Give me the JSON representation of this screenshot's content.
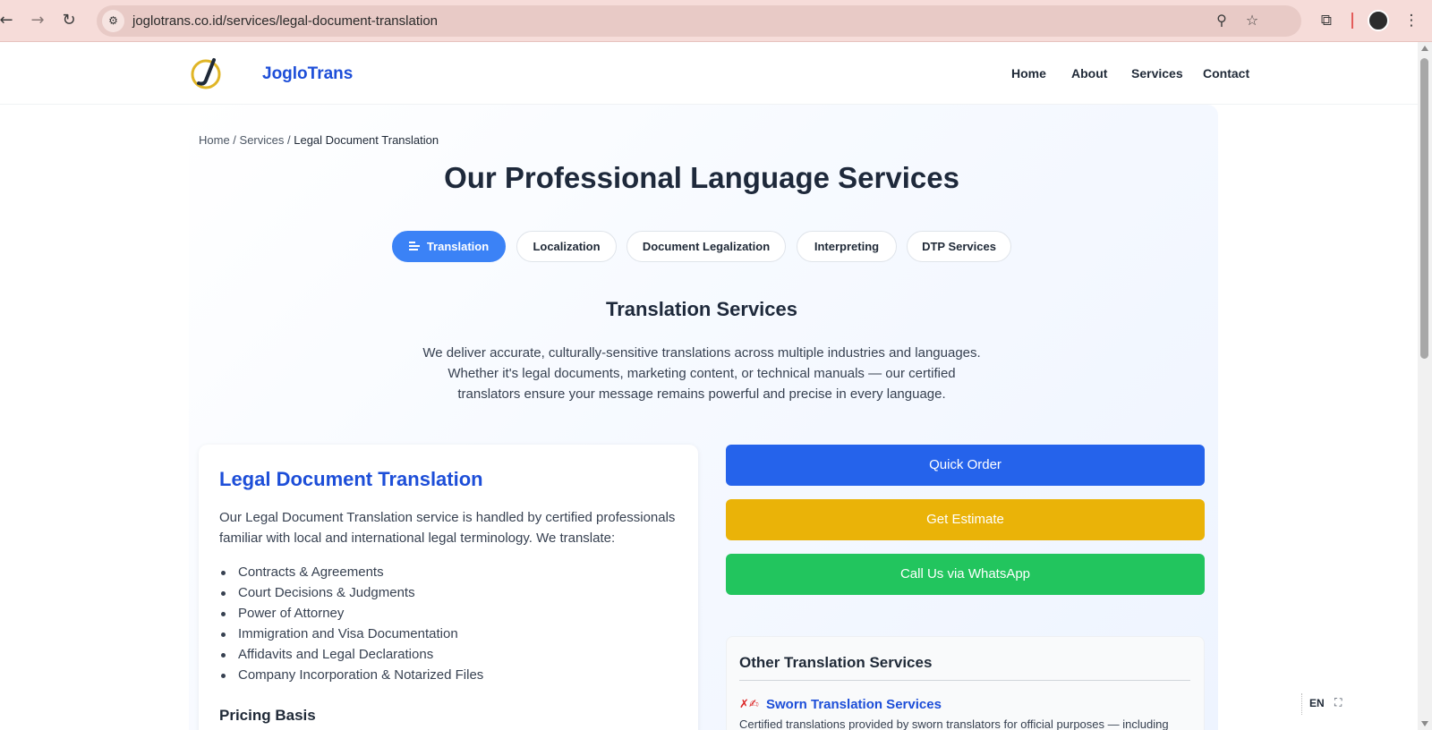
{
  "browser": {
    "url": "joglotrans.co.id/services/legal-document-translation",
    "icons": {
      "back": "arrow-left-icon",
      "forward": "arrow-right-icon",
      "reload": "reload-icon",
      "site_info": "tune-icon",
      "zoom": "zoom-icon",
      "bookmark": "star-icon",
      "extensions": "puzzle-icon",
      "menu": "kebab-menu-icon"
    }
  },
  "header": {
    "brand": "JogloTrans",
    "nav": [
      "Home",
      "About",
      "Services",
      "Contact"
    ]
  },
  "breadcrumb": {
    "home": "Home",
    "sep1": " / ",
    "services": "Services",
    "sep2": " / ",
    "current": "Legal Document Translation"
  },
  "page_title": "Our Professional Language Services",
  "tabs": [
    {
      "label": "Translation",
      "active": true
    },
    {
      "label": "Localization",
      "active": false
    },
    {
      "label": "Document Legalization",
      "active": false
    },
    {
      "label": "Interpreting",
      "active": false
    },
    {
      "label": "DTP Services",
      "active": false
    }
  ],
  "section": {
    "title": "Translation Services",
    "desc_line1": "We deliver accurate, culturally-sensitive translations across multiple industries and languages.",
    "desc_line2": "Whether it's legal documents, marketing content, or technical manuals — our certified",
    "desc_line3": "translators ensure your message remains powerful and precise in every language."
  },
  "card": {
    "title": "Legal Document Translation",
    "intro": "Our Legal Document Translation service is handled by certified professionals familiar with local and international legal terminology. We translate:",
    "items": [
      "Contracts & Agreements",
      "Court Decisions & Judgments",
      "Power of Attorney",
      "Immigration and Visa Documentation",
      "Affidavits and Legal Declarations",
      "Company Incorporation & Notarized Files"
    ],
    "pricing_title": "Pricing Basis"
  },
  "actions": {
    "quick_order": "Quick Order",
    "estimate": "Get Estimate",
    "whatsapp": "Call Us via WhatsApp"
  },
  "other_services": {
    "title": "Other Translation Services",
    "item_title": "Sworn Translation Services",
    "item_desc": "Certified translations provided by sworn translators for official purposes — including"
  },
  "language_widget": {
    "label": "EN"
  },
  "colors": {
    "primary": "#2563eb",
    "estimate": "#eab308",
    "whatsapp": "#22c55e",
    "brand": "#1d4ed8"
  }
}
